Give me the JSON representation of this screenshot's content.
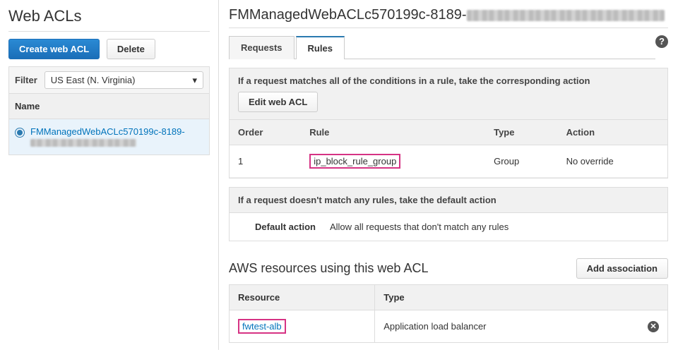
{
  "left": {
    "title": "Web ACLs",
    "create_btn": "Create web ACL",
    "delete_btn": "Delete",
    "filter_label": "Filter",
    "region_selected": "US East (N. Virginia)",
    "name_header": "Name",
    "acl_items": [
      {
        "name": "FMManagedWebACLc570199c-8189-"
      }
    ]
  },
  "right": {
    "detail_title_prefix": "FMManagedWebACLc570199c-8189-",
    "tabs": [
      {
        "label": "Requests",
        "active": false
      },
      {
        "label": "Rules",
        "active": true
      }
    ],
    "match_panel": {
      "heading": "If a request matches all of the conditions in a rule, take the corresponding action",
      "edit_btn": "Edit web ACL",
      "columns": {
        "order": "Order",
        "rule": "Rule",
        "type": "Type",
        "action": "Action"
      },
      "rows": [
        {
          "order": "1",
          "rule": "ip_block_rule_group",
          "type": "Group",
          "action": "No override"
        }
      ]
    },
    "default_panel": {
      "heading": "If a request doesn't match any rules, take the default action",
      "label": "Default action",
      "value": "Allow all requests that don't match any rules"
    },
    "resources": {
      "title": "AWS resources using this web ACL",
      "add_btn": "Add association",
      "columns": {
        "resource": "Resource",
        "type": "Type"
      },
      "rows": [
        {
          "resource": "fwtest-alb",
          "type": "Application load balancer"
        }
      ]
    }
  }
}
